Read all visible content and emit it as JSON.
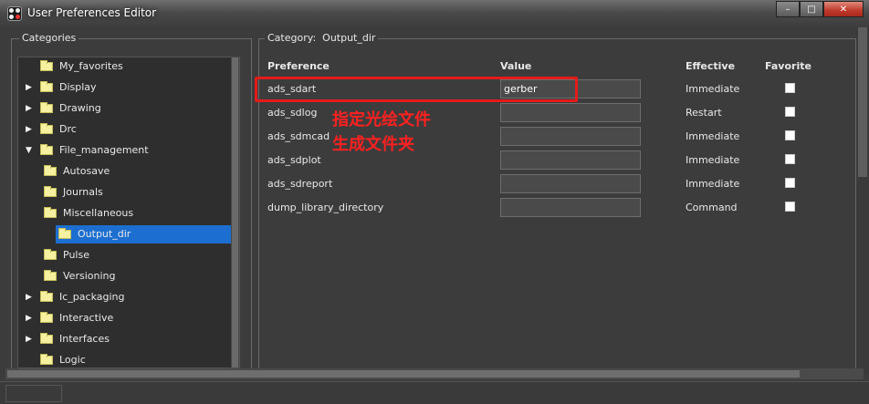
{
  "window": {
    "title": "User Preferences Editor",
    "buttons": [
      "–",
      "□",
      "✕"
    ]
  },
  "categories": {
    "title": "Categories",
    "items": [
      {
        "label": "My_favorites",
        "arrow": "",
        "depth": 0
      },
      {
        "label": "Display",
        "arrow": "▶",
        "depth": 0
      },
      {
        "label": "Drawing",
        "arrow": "▶",
        "depth": 0
      },
      {
        "label": "Drc",
        "arrow": "▶",
        "depth": 0
      },
      {
        "label": "File_management",
        "arrow": "▼",
        "depth": 0
      },
      {
        "label": "Autosave",
        "arrow": "",
        "depth": 1
      },
      {
        "label": "Journals",
        "arrow": "",
        "depth": 1
      },
      {
        "label": "Miscellaneous",
        "arrow": "",
        "depth": 1
      },
      {
        "label": "Output_dir",
        "arrow": "",
        "depth": 1,
        "selected": true
      },
      {
        "label": "Pulse",
        "arrow": "",
        "depth": 1
      },
      {
        "label": "Versioning",
        "arrow": "",
        "depth": 1
      },
      {
        "label": "Ic_packaging",
        "arrow": "▶",
        "depth": 0
      },
      {
        "label": "Interactive",
        "arrow": "▶",
        "depth": 0
      },
      {
        "label": "Interfaces",
        "arrow": "▶",
        "depth": 0
      },
      {
        "label": "Logic",
        "arrow": "",
        "depth": 0
      }
    ]
  },
  "preferences": {
    "category_label": "Category:",
    "category_value": "Output_dir",
    "headers": {
      "preference": "Preference",
      "value": "Value",
      "effective": "Effective",
      "favorite": "Favorite"
    },
    "rows": [
      {
        "name": "ads_sdart",
        "value": "gerber",
        "effective": "Immediate",
        "favorite": false
      },
      {
        "name": "ads_sdlog",
        "value": "",
        "effective": "Restart",
        "favorite": false
      },
      {
        "name": "ads_sdmcad",
        "value": "",
        "effective": "Immediate",
        "favorite": false
      },
      {
        "name": "ads_sdplot",
        "value": "",
        "effective": "Immediate",
        "favorite": false
      },
      {
        "name": "ads_sdreport",
        "value": "",
        "effective": "Immediate",
        "favorite": false
      },
      {
        "name": "dump_library_directory",
        "value": "",
        "effective": "Command",
        "favorite": false
      }
    ]
  },
  "annotation": {
    "line1": "指定光绘文件",
    "line2": "生成文件夹",
    "color": "#ff2020"
  },
  "colors": {
    "selection": "#1c6fd0",
    "highlight_box": "#e41b1b",
    "folder": "#f5f1a0"
  }
}
